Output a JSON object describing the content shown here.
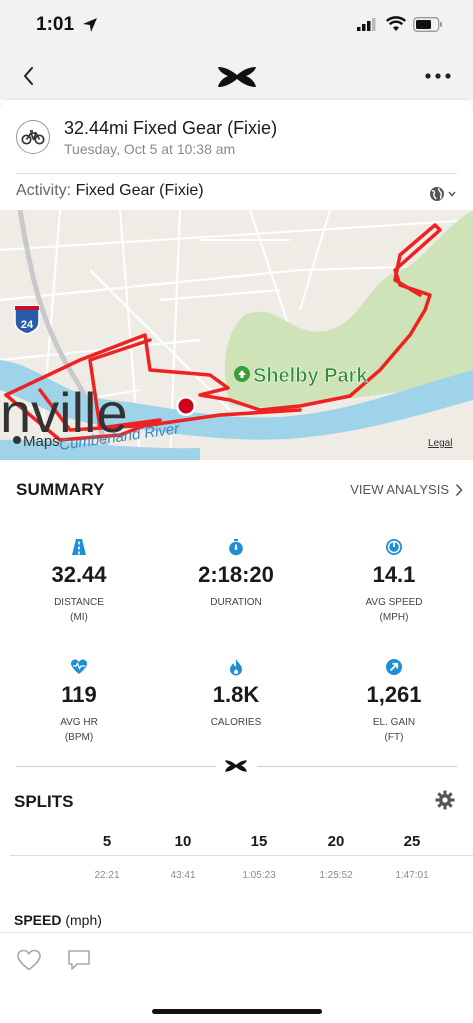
{
  "status_bar": {
    "time": "1:01"
  },
  "workout": {
    "title": "32.44mi Fixed Gear (Fixie)",
    "date": "Tuesday, Oct 5 at 10:38 am",
    "activity_label": "Activity:",
    "activity_value": "Fixed Gear (Fixie)"
  },
  "map": {
    "place_label": "Shelby Park",
    "city_fragment": "nville",
    "river_label": "Cumberland River",
    "highway_shield": "24",
    "maps_label": "Maps",
    "legal_label": "Legal",
    "route_color": "#ee2222",
    "park_color": "#cfe3b8",
    "water_color": "#9fd3ea"
  },
  "summary": {
    "title": "SUMMARY",
    "view_analysis": "VIEW ANALYSIS",
    "accent_color": "#1e8fd6",
    "stats": [
      {
        "icon": "road-icon",
        "value": "32.44",
        "label": "DISTANCE",
        "unit": "(MI)"
      },
      {
        "icon": "stopwatch-icon",
        "value": "2:18:20",
        "label": "DURATION",
        "unit": ""
      },
      {
        "icon": "speedometer-icon",
        "value": "14.1",
        "label": "AVG SPEED",
        "unit": "(MPH)"
      },
      {
        "icon": "heart-rate-icon",
        "value": "119",
        "label": "AVG HR",
        "unit": "(BPM)"
      },
      {
        "icon": "flame-icon",
        "value": "1.8K",
        "label": "CALORIES",
        "unit": ""
      },
      {
        "icon": "elevation-arrow-icon",
        "value": "1,261",
        "label": "EL. GAIN",
        "unit": "(FT)"
      }
    ]
  },
  "splits": {
    "title": "SPLITS",
    "items": [
      {
        "mile": "5",
        "time": "22:21"
      },
      {
        "mile": "10",
        "time": "43:41"
      },
      {
        "mile": "15",
        "time": "1:05:23"
      },
      {
        "mile": "20",
        "time": "1:25:52"
      },
      {
        "mile": "25",
        "time": "1:47:01"
      }
    ]
  },
  "speed": {
    "title": "SPEED",
    "unit": "(mph)"
  }
}
